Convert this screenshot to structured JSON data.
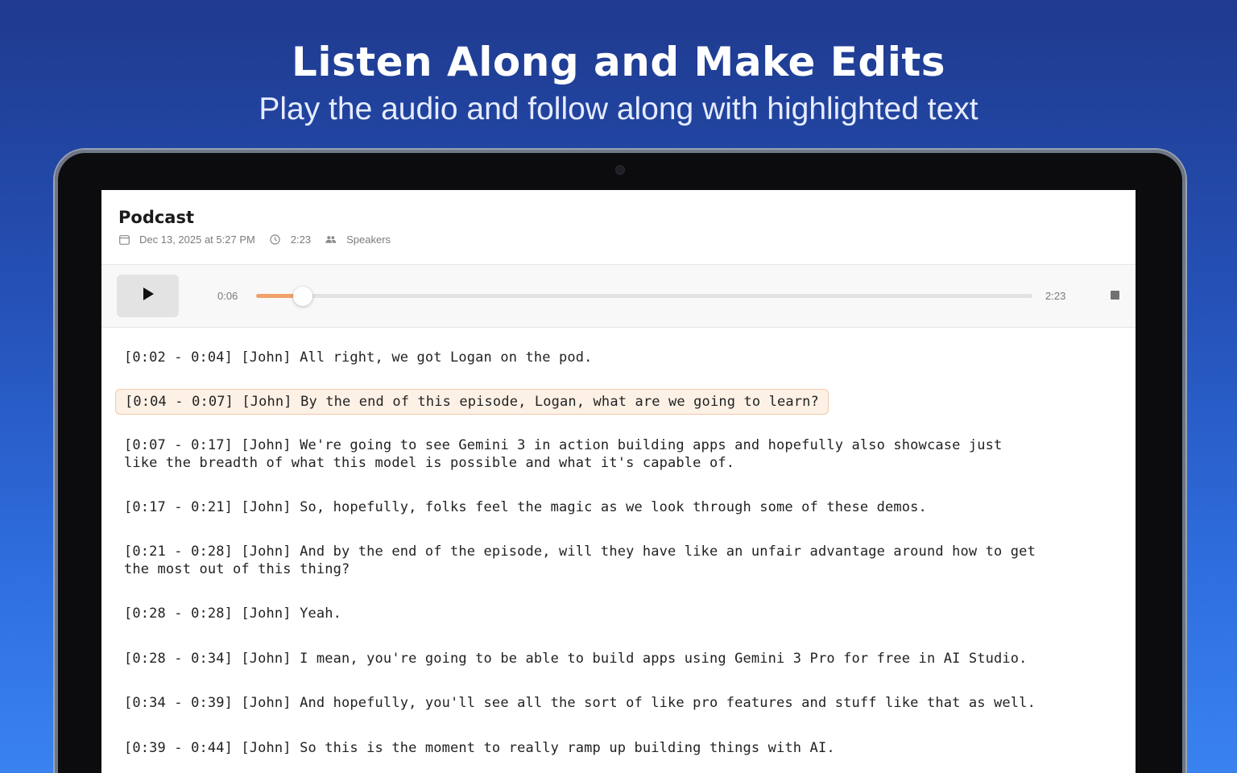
{
  "promo": {
    "headline": "Listen Along and Make Edits",
    "subheadline": "Play the audio and follow along with highlighted text"
  },
  "document": {
    "title": "Podcast",
    "date": "Dec 13, 2025 at 5:27 PM",
    "duration": "2:23",
    "speakers_label": "Speakers",
    "icons": {
      "date": "calendar-icon",
      "duration": "clock-icon",
      "speakers": "people-icon"
    }
  },
  "player": {
    "current_time": "0:06",
    "total_time": "2:23",
    "progress": 0.06,
    "accent_color": "#f2a16a",
    "play_icon": "play-icon",
    "stop_icon": "stop-icon"
  },
  "transcript": {
    "active_index": 1,
    "segments": [
      "[0:02 - 0:04] [John] All right, we got Logan on the pod.",
      "[0:04 - 0:07] [John] By the end of this episode, Logan, what are we going to learn?",
      "[0:07 - 0:17] [John] We're going to see Gemini 3 in action building apps and hopefully also showcase just\nlike the breadth of what this model is possible and what it's capable of.",
      "[0:17 - 0:21] [John] So, hopefully, folks feel the magic as we look through some of these demos.",
      "[0:21 - 0:28] [John] And by the end of the episode, will they have like an unfair advantage around how to get\nthe most out of this thing?",
      "[0:28 - 0:28] [John] Yeah.",
      "[0:28 - 0:34] [John] I mean, you're going to be able to build apps using Gemini 3 Pro for free in AI Studio.",
      "[0:34 - 0:39] [John] And hopefully, you'll see all the sort of like pro features and stuff like that as well.",
      "[0:39 - 0:44] [John] So this is the moment to really ramp up building things with AI."
    ]
  }
}
